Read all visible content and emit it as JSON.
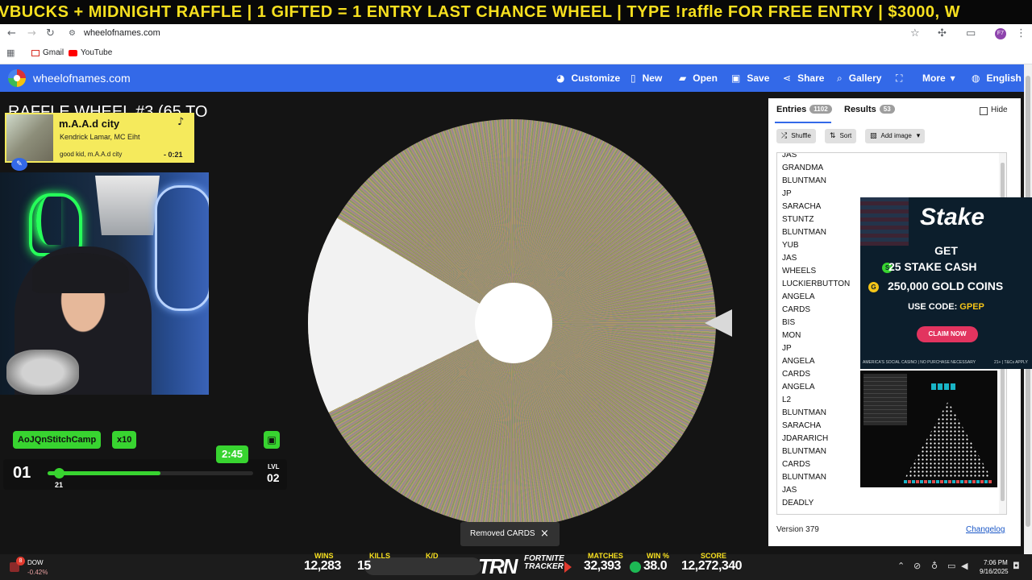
{
  "ticker": {
    "text": "VBUCKS + MIDNIGHT RAFFLE | 1 GIFTED = 1 ENTRY LAST CHANCE WHEEL | TYPE !raffle FOR FREE ENTRY | $3000, W"
  },
  "browser": {
    "url": "wheelofnames.com",
    "profile_initials": "F7",
    "bookmarks": [
      {
        "label": "Gmail"
      },
      {
        "label": "YouTube"
      }
    ]
  },
  "app": {
    "site_title": "wheelofnames.com",
    "nav": [
      {
        "label": "Customize"
      },
      {
        "label": "New"
      },
      {
        "label": "Open"
      },
      {
        "label": "Save"
      },
      {
        "label": "Share"
      },
      {
        "label": "Gallery"
      },
      {
        "label": "More"
      },
      {
        "label": "English"
      }
    ],
    "accent_color": "#3369e8"
  },
  "wheel": {
    "title": "RAFFLE WHEEL #3 (65 TO"
  },
  "toast": {
    "message": "Removed CARDS"
  },
  "panel": {
    "tabs": [
      {
        "label": "Entries",
        "count": "1102"
      },
      {
        "label": "Results",
        "count": "53"
      }
    ],
    "hide_label": "Hide",
    "buttons": {
      "shuffle": "Shuffle",
      "sort": "Sort",
      "add_image": "Add image"
    },
    "entries": [
      "JAS",
      "GRANDMA",
      "BLUNTMAN",
      "JP",
      "SARACHA",
      "STUNTZ",
      "BLUNTMAN",
      "YUB",
      "JAS",
      "WHEELS",
      "LUCKIERBUTTON",
      "ANGELA",
      "CARDS",
      "BIS",
      "MON",
      "JP",
      "ANGELA",
      "CARDS",
      "ANGELA",
      "L2",
      "BLUNTMAN",
      "SARACHA",
      "JDARARICH",
      "BLUNTMAN",
      "CARDS",
      "BLUNTMAN",
      "JAS",
      "DEADLY"
    ],
    "version": "Version 379",
    "changelog": "Changelog"
  },
  "stake_ad": {
    "brand": "Stake",
    "get": "GET",
    "line1": "25 STAKE CASH",
    "line2": "250,000 GOLD COINS",
    "code_prefix": "USE CODE: ",
    "code": "GPEP",
    "cta": "CLAIM NOW",
    "disclaimer": "AMERICA'S SOCIAL CASINO | NO PURCHASE NECESSARY",
    "tcs": "21+ | T&Cs APPLY"
  },
  "music": {
    "song": "m.A.A.d city",
    "artist": "Kendrick Lamar, MC Eiht",
    "album": "good kid, m.A.A.d city",
    "time_remaining": "- 0:21"
  },
  "hud": {
    "gamer_tag": "AoJQnStitchCamp",
    "multiplier": "x10",
    "timer": "2:45",
    "level": "01",
    "progress_value": "21",
    "level_label": "LVL",
    "next_level": "02",
    "progress_fraction": 0.55
  },
  "taskbar": {
    "dow_badge": "8",
    "dow_name": "DOW",
    "dow_change": "-0.42%",
    "stats": [
      {
        "label": "WINS",
        "value": "12,283"
      },
      {
        "label": "KILLS",
        "value": "15"
      },
      {
        "label": "K/D",
        "value": ""
      },
      {
        "label": "MATCHES",
        "value": "32,393"
      },
      {
        "label": "WIN %",
        "value": "38.0"
      },
      {
        "label": "SCORE",
        "value": "12,272,340"
      }
    ],
    "trn": "TRN",
    "trn_sub1": "FORTNITE",
    "trn_sub2": "TRACKER",
    "clock_time": "7:06 PM",
    "clock_date": "9/16/2025"
  }
}
